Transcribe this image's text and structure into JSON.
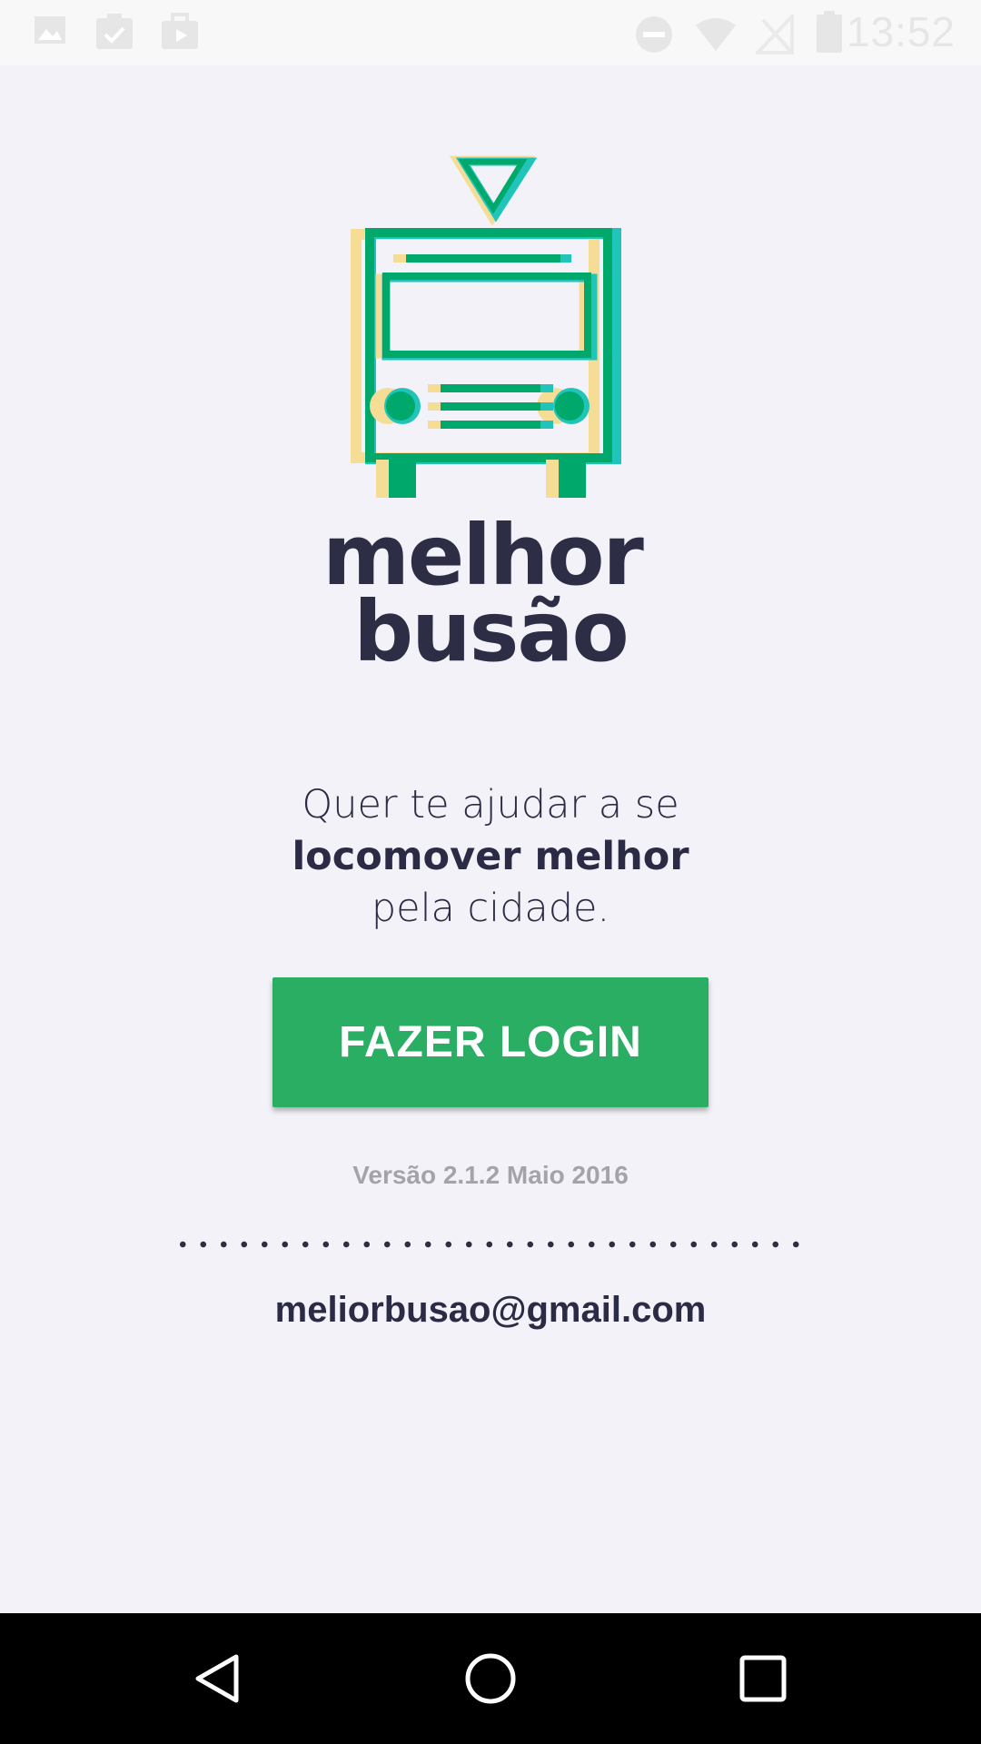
{
  "status_bar": {
    "time": "13:52",
    "left_icons": [
      "image-icon",
      "clipboard-check-icon",
      "briefcase-icon"
    ],
    "right_icons": [
      "minus-circle-icon",
      "wifi-icon",
      "no-signal-icon",
      "battery-icon"
    ]
  },
  "app": {
    "logo_icon": "bus-icon",
    "name_line1": "melhor",
    "name_line2": "busão",
    "colors": {
      "dark": "#2d2d45",
      "green": "#00a86b",
      "teal": "#21c4b8",
      "yellow": "#f6dd96",
      "button": "#29ae63"
    }
  },
  "tagline": {
    "line1": "Quer te ajudar a se",
    "line2": "locomover melhor",
    "line3": "pela cidade."
  },
  "login_button": {
    "label": "FAZER LOGIN"
  },
  "version": "Versão 2.1.2 Maio 2016",
  "email": "meliorbusao@gmail.com",
  "nav_bar": {
    "buttons": [
      "back-icon",
      "home-icon",
      "recents-icon"
    ]
  }
}
